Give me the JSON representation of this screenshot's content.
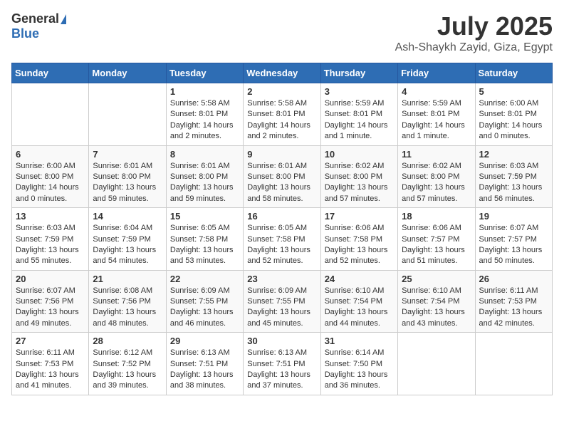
{
  "header": {
    "logo_general": "General",
    "logo_blue": "Blue",
    "title_month": "July 2025",
    "title_location": "Ash-Shaykh Zayid, Giza, Egypt"
  },
  "weekdays": [
    "Sunday",
    "Monday",
    "Tuesday",
    "Wednesday",
    "Thursday",
    "Friday",
    "Saturday"
  ],
  "weeks": [
    [
      null,
      null,
      {
        "day": "1",
        "sunrise": "Sunrise: 5:58 AM",
        "sunset": "Sunset: 8:01 PM",
        "daylight": "Daylight: 14 hours and 2 minutes."
      },
      {
        "day": "2",
        "sunrise": "Sunrise: 5:58 AM",
        "sunset": "Sunset: 8:01 PM",
        "daylight": "Daylight: 14 hours and 2 minutes."
      },
      {
        "day": "3",
        "sunrise": "Sunrise: 5:59 AM",
        "sunset": "Sunset: 8:01 PM",
        "daylight": "Daylight: 14 hours and 1 minute."
      },
      {
        "day": "4",
        "sunrise": "Sunrise: 5:59 AM",
        "sunset": "Sunset: 8:01 PM",
        "daylight": "Daylight: 14 hours and 1 minute."
      },
      {
        "day": "5",
        "sunrise": "Sunrise: 6:00 AM",
        "sunset": "Sunset: 8:01 PM",
        "daylight": "Daylight: 14 hours and 0 minutes."
      }
    ],
    [
      {
        "day": "6",
        "sunrise": "Sunrise: 6:00 AM",
        "sunset": "Sunset: 8:00 PM",
        "daylight": "Daylight: 14 hours and 0 minutes."
      },
      {
        "day": "7",
        "sunrise": "Sunrise: 6:01 AM",
        "sunset": "Sunset: 8:00 PM",
        "daylight": "Daylight: 13 hours and 59 minutes."
      },
      {
        "day": "8",
        "sunrise": "Sunrise: 6:01 AM",
        "sunset": "Sunset: 8:00 PM",
        "daylight": "Daylight: 13 hours and 59 minutes."
      },
      {
        "day": "9",
        "sunrise": "Sunrise: 6:01 AM",
        "sunset": "Sunset: 8:00 PM",
        "daylight": "Daylight: 13 hours and 58 minutes."
      },
      {
        "day": "10",
        "sunrise": "Sunrise: 6:02 AM",
        "sunset": "Sunset: 8:00 PM",
        "daylight": "Daylight: 13 hours and 57 minutes."
      },
      {
        "day": "11",
        "sunrise": "Sunrise: 6:02 AM",
        "sunset": "Sunset: 8:00 PM",
        "daylight": "Daylight: 13 hours and 57 minutes."
      },
      {
        "day": "12",
        "sunrise": "Sunrise: 6:03 AM",
        "sunset": "Sunset: 7:59 PM",
        "daylight": "Daylight: 13 hours and 56 minutes."
      }
    ],
    [
      {
        "day": "13",
        "sunrise": "Sunrise: 6:03 AM",
        "sunset": "Sunset: 7:59 PM",
        "daylight": "Daylight: 13 hours and 55 minutes."
      },
      {
        "day": "14",
        "sunrise": "Sunrise: 6:04 AM",
        "sunset": "Sunset: 7:59 PM",
        "daylight": "Daylight: 13 hours and 54 minutes."
      },
      {
        "day": "15",
        "sunrise": "Sunrise: 6:05 AM",
        "sunset": "Sunset: 7:58 PM",
        "daylight": "Daylight: 13 hours and 53 minutes."
      },
      {
        "day": "16",
        "sunrise": "Sunrise: 6:05 AM",
        "sunset": "Sunset: 7:58 PM",
        "daylight": "Daylight: 13 hours and 52 minutes."
      },
      {
        "day": "17",
        "sunrise": "Sunrise: 6:06 AM",
        "sunset": "Sunset: 7:58 PM",
        "daylight": "Daylight: 13 hours and 52 minutes."
      },
      {
        "day": "18",
        "sunrise": "Sunrise: 6:06 AM",
        "sunset": "Sunset: 7:57 PM",
        "daylight": "Daylight: 13 hours and 51 minutes."
      },
      {
        "day": "19",
        "sunrise": "Sunrise: 6:07 AM",
        "sunset": "Sunset: 7:57 PM",
        "daylight": "Daylight: 13 hours and 50 minutes."
      }
    ],
    [
      {
        "day": "20",
        "sunrise": "Sunrise: 6:07 AM",
        "sunset": "Sunset: 7:56 PM",
        "daylight": "Daylight: 13 hours and 49 minutes."
      },
      {
        "day": "21",
        "sunrise": "Sunrise: 6:08 AM",
        "sunset": "Sunset: 7:56 PM",
        "daylight": "Daylight: 13 hours and 48 minutes."
      },
      {
        "day": "22",
        "sunrise": "Sunrise: 6:09 AM",
        "sunset": "Sunset: 7:55 PM",
        "daylight": "Daylight: 13 hours and 46 minutes."
      },
      {
        "day": "23",
        "sunrise": "Sunrise: 6:09 AM",
        "sunset": "Sunset: 7:55 PM",
        "daylight": "Daylight: 13 hours and 45 minutes."
      },
      {
        "day": "24",
        "sunrise": "Sunrise: 6:10 AM",
        "sunset": "Sunset: 7:54 PM",
        "daylight": "Daylight: 13 hours and 44 minutes."
      },
      {
        "day": "25",
        "sunrise": "Sunrise: 6:10 AM",
        "sunset": "Sunset: 7:54 PM",
        "daylight": "Daylight: 13 hours and 43 minutes."
      },
      {
        "day": "26",
        "sunrise": "Sunrise: 6:11 AM",
        "sunset": "Sunset: 7:53 PM",
        "daylight": "Daylight: 13 hours and 42 minutes."
      }
    ],
    [
      {
        "day": "27",
        "sunrise": "Sunrise: 6:11 AM",
        "sunset": "Sunset: 7:53 PM",
        "daylight": "Daylight: 13 hours and 41 minutes."
      },
      {
        "day": "28",
        "sunrise": "Sunrise: 6:12 AM",
        "sunset": "Sunset: 7:52 PM",
        "daylight": "Daylight: 13 hours and 39 minutes."
      },
      {
        "day": "29",
        "sunrise": "Sunrise: 6:13 AM",
        "sunset": "Sunset: 7:51 PM",
        "daylight": "Daylight: 13 hours and 38 minutes."
      },
      {
        "day": "30",
        "sunrise": "Sunrise: 6:13 AM",
        "sunset": "Sunset: 7:51 PM",
        "daylight": "Daylight: 13 hours and 37 minutes."
      },
      {
        "day": "31",
        "sunrise": "Sunrise: 6:14 AM",
        "sunset": "Sunset: 7:50 PM",
        "daylight": "Daylight: 13 hours and 36 minutes."
      },
      null,
      null
    ]
  ]
}
